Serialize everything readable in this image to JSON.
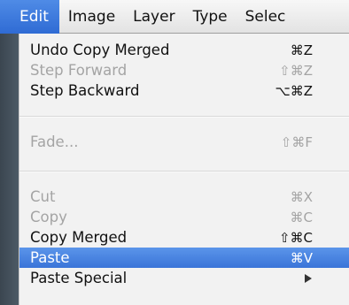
{
  "menubar": {
    "items": [
      {
        "label": "Edit"
      },
      {
        "label": "Image"
      },
      {
        "label": "Layer"
      },
      {
        "label": "Type"
      },
      {
        "label": "Selec"
      }
    ]
  },
  "edit_menu": {
    "items": [
      {
        "label": "Undo Copy Merged",
        "shortcut": "⌘Z",
        "enabled": true
      },
      {
        "label": "Step Forward",
        "shortcut": "⇧⌘Z",
        "enabled": false
      },
      {
        "label": "Step Backward",
        "shortcut": "⌥⌘Z",
        "enabled": true
      },
      {
        "label": "Fade...",
        "shortcut": "⇧⌘F",
        "enabled": false
      },
      {
        "label": "Cut",
        "shortcut": "⌘X",
        "enabled": false
      },
      {
        "label": "Copy",
        "shortcut": "⌘C",
        "enabled": false
      },
      {
        "label": "Copy Merged",
        "shortcut": "⇧⌘C",
        "enabled": true
      },
      {
        "label": "Paste",
        "shortcut": "⌘V",
        "enabled": true,
        "selected": true
      },
      {
        "label": "Paste Special",
        "shortcut": "",
        "enabled": true,
        "submenu": true
      }
    ]
  }
}
